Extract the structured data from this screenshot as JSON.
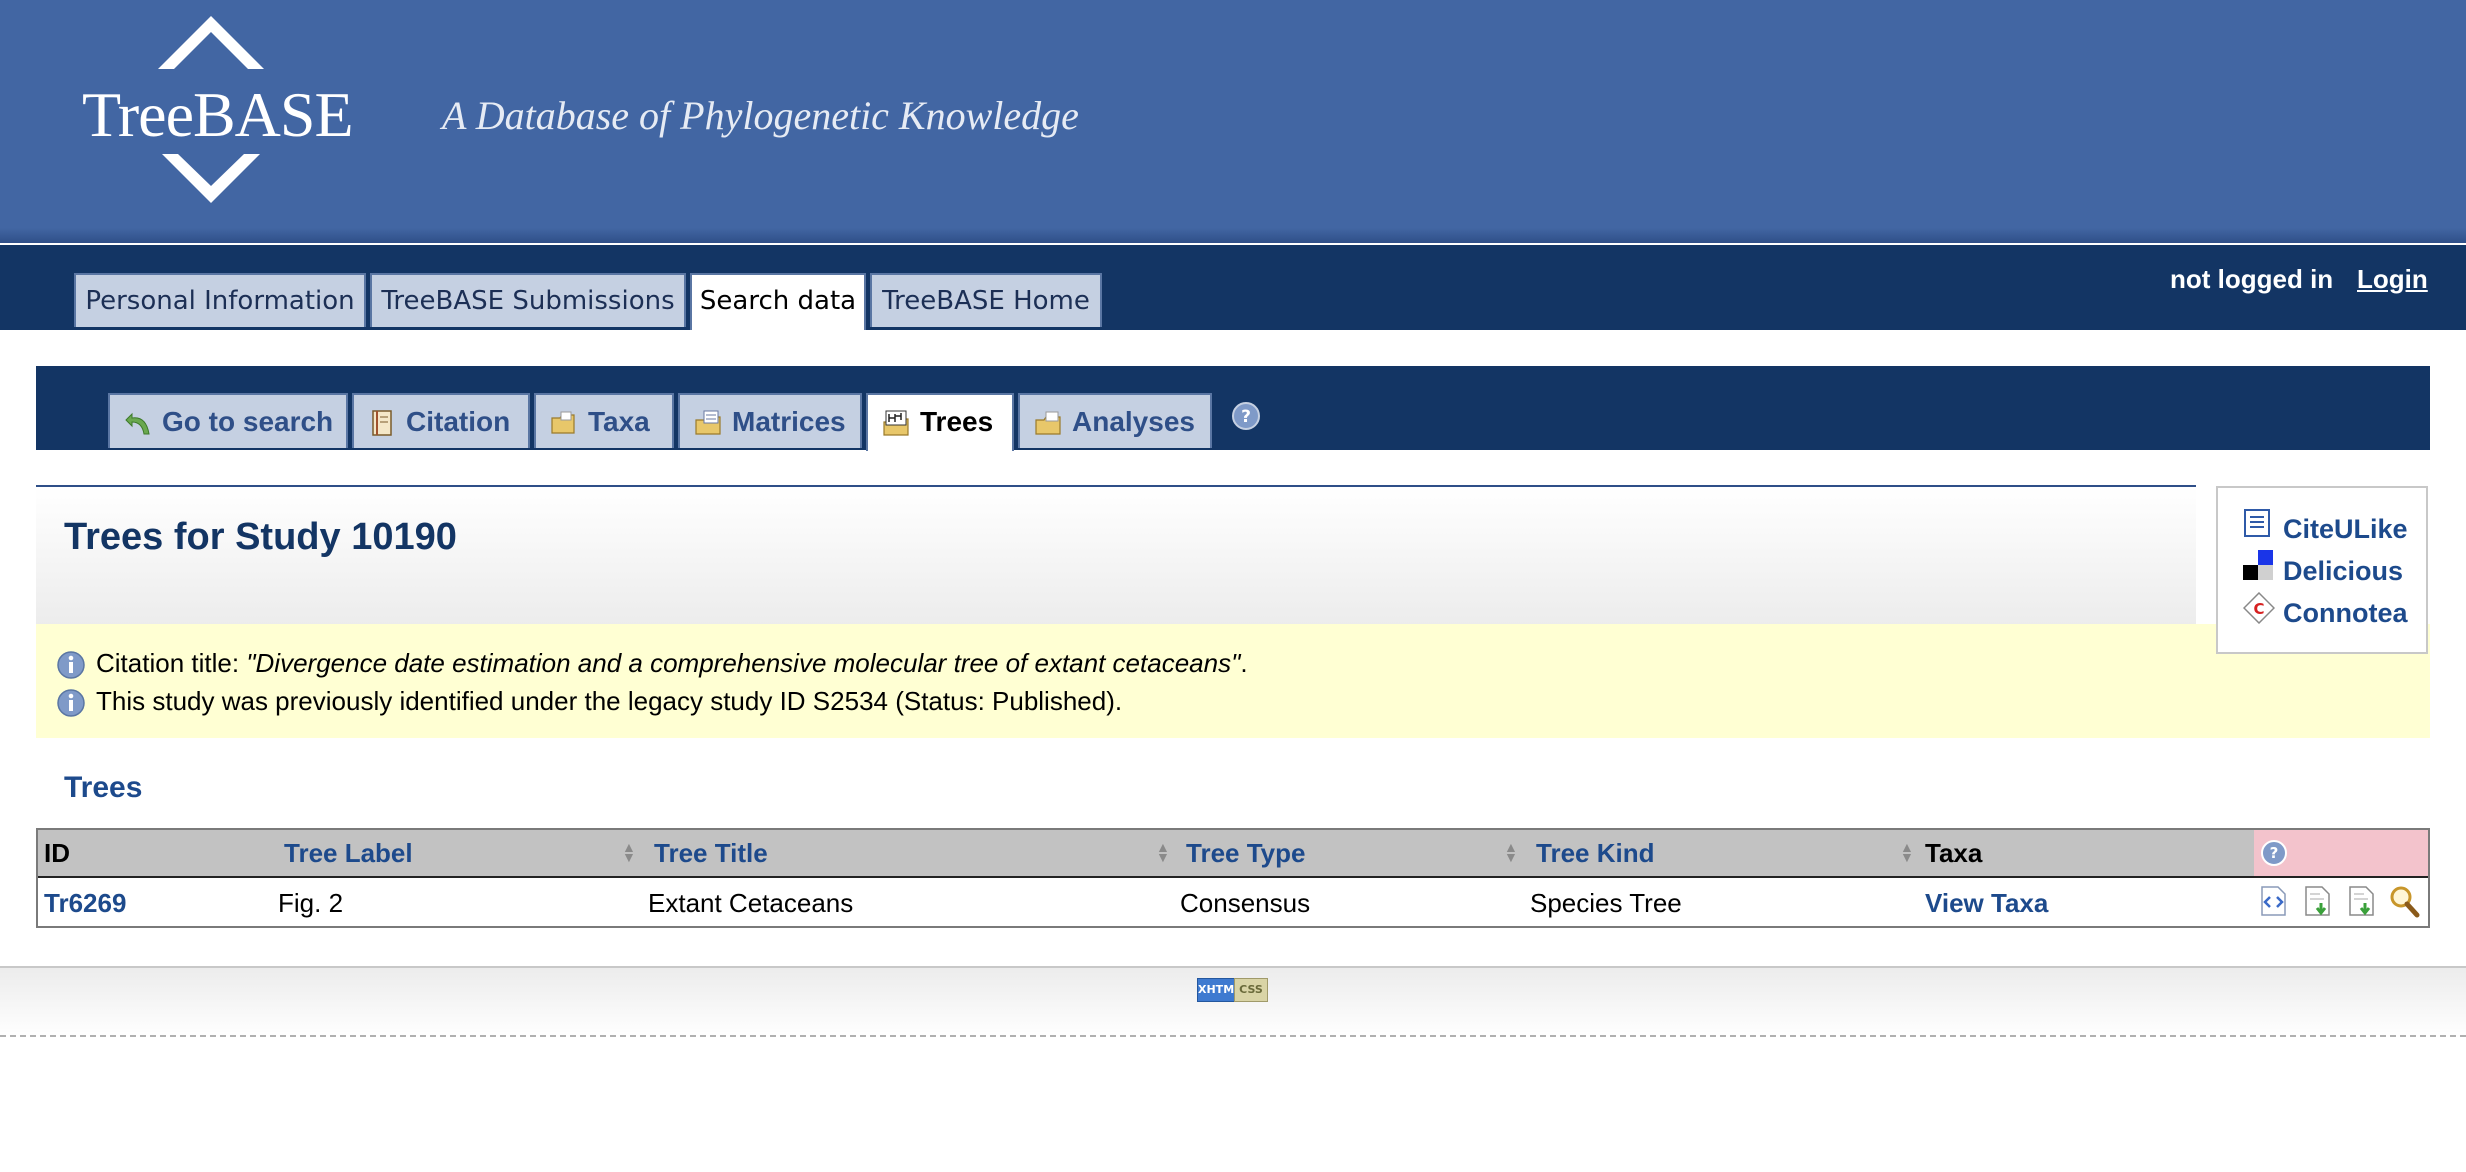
{
  "header": {
    "logo_text": "TreeBASE",
    "tagline": "A Database of Phylogenetic Knowledge"
  },
  "top_nav": {
    "tabs": [
      {
        "label": "Personal Information",
        "active": false
      },
      {
        "label": "TreeBASE Submissions",
        "active": false
      },
      {
        "label": "Search data",
        "active": true
      },
      {
        "label": "TreeBASE Home",
        "active": false
      }
    ],
    "login_status": "not logged in",
    "login_link": "Login"
  },
  "sub_nav": {
    "tabs": [
      {
        "label": "Go to search",
        "icon": "back-arrow-icon",
        "active": false
      },
      {
        "label": "Citation",
        "icon": "notebook-icon",
        "active": false
      },
      {
        "label": "Taxa",
        "icon": "folder-icon",
        "active": false
      },
      {
        "label": "Matrices",
        "icon": "matrix-icon",
        "active": false
      },
      {
        "label": "Trees",
        "icon": "tree-icon",
        "active": true
      },
      {
        "label": "Analyses",
        "icon": "folder-icon",
        "active": false
      }
    ]
  },
  "page": {
    "title": "Trees for Study 10190",
    "notices": [
      {
        "prefix": "Citation title: ",
        "emphasis": "\"Divergence date estimation and a comprehensive molecular tree of extant cetaceans\"",
        "suffix": "."
      },
      {
        "prefix": "This study was previously identified under the legacy study ID S2534 (Status: Published).",
        "emphasis": "",
        "suffix": ""
      }
    ],
    "section_heading": "Trees"
  },
  "social": {
    "links": [
      {
        "label": "CiteULike",
        "icon": "citeulike-icon"
      },
      {
        "label": "Delicious",
        "icon": "delicious-icon"
      },
      {
        "label": "Connotea",
        "icon": "connotea-icon"
      }
    ]
  },
  "table": {
    "columns": [
      "ID",
      "Tree Label",
      "Tree Title",
      "Tree Type",
      "Tree Kind",
      "Taxa"
    ],
    "rows": [
      {
        "id": "Tr6269",
        "label": "Fig. 2",
        "title": "Extant Cetaceans",
        "type": "Consensus",
        "kind": "Species Tree",
        "taxa": "View Taxa",
        "actions": [
          "view-tree-icon",
          "download-nexus-icon",
          "download-nexml-icon",
          "search-icon"
        ]
      }
    ]
  },
  "footer": {
    "badges": [
      "XHTML",
      "CSS"
    ]
  },
  "colors": {
    "header_bg": "#4266a3",
    "nav_bg": "#133564",
    "tab_bg": "#c5d0e2",
    "link": "#1d4a8c",
    "notice_bg": "#ffffd3",
    "help_cell_bg": "#f3c3cc"
  }
}
